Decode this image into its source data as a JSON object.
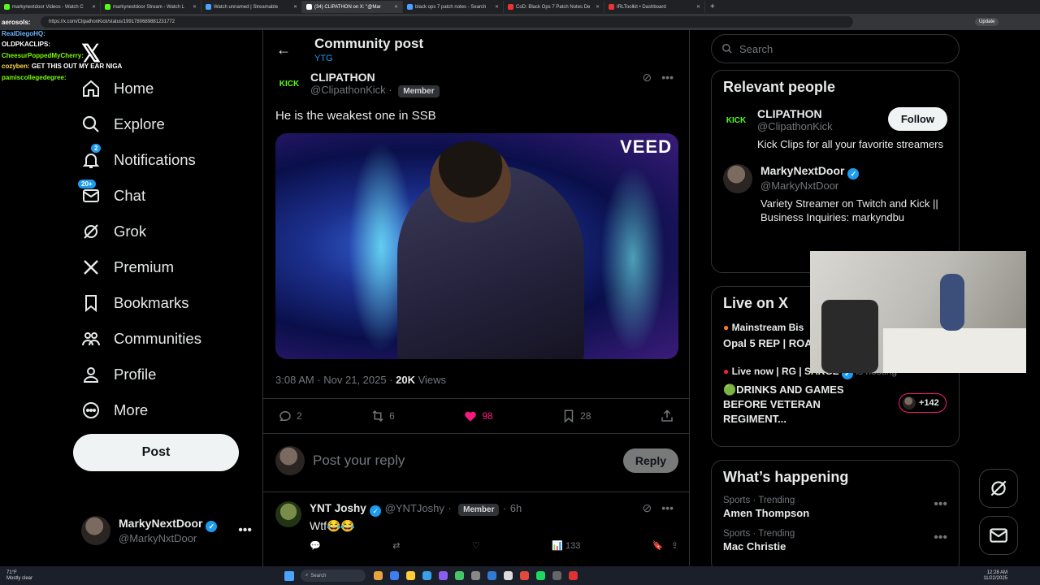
{
  "browser": {
    "tabs": [
      {
        "label": "markynextdoor Videos - Watch C",
        "active": false
      },
      {
        "label": "markynextdoor Stream - Watch L",
        "active": false
      },
      {
        "label": "Watch unnamed | Streamable",
        "active": false
      },
      {
        "label": "(34) CLIPATHON on X: \"@Mar",
        "active": true
      },
      {
        "label": "black ops 7 patch notes - Search",
        "active": false
      },
      {
        "label": "CoD: Black Ops 7 Patch Notes De",
        "active": false
      },
      {
        "label": "IRLToolkit • Dashboard",
        "active": false
      }
    ],
    "url": "https://x.com/ClipathonKick/status/1991780689881231772",
    "update_label": "Update"
  },
  "chat_overlay": [
    {
      "user": "aerosols:",
      "msg": ""
    },
    {
      "user": "RealDiegoHQ:",
      "msg": ""
    },
    {
      "user": "OLDPKACLIPS:",
      "msg": ""
    },
    {
      "user": "CheesurPoppedMyCherry:",
      "msg": ""
    },
    {
      "user": "cozyben:",
      "msg": "GET THIS OUT MY EAR NIGA"
    },
    {
      "user": "pamiscollegedegree:",
      "msg": ""
    }
  ],
  "nav": [
    {
      "label": "Home",
      "icon": "home-icon",
      "badge": ""
    },
    {
      "label": "Explore",
      "icon": "search-icon",
      "badge": ""
    },
    {
      "label": "Notifications",
      "icon": "bell-icon",
      "badge": "2"
    },
    {
      "label": "Chat",
      "icon": "mail-icon",
      "badge": "20+"
    },
    {
      "label": "Grok",
      "icon": "grok-icon",
      "badge": ""
    },
    {
      "label": "Premium",
      "icon": "x-icon",
      "badge": ""
    },
    {
      "label": "Bookmarks",
      "icon": "bookmark-icon",
      "badge": ""
    },
    {
      "label": "Communities",
      "icon": "communities-icon",
      "badge": ""
    },
    {
      "label": "Profile",
      "icon": "profile-icon",
      "badge": ""
    },
    {
      "label": "More",
      "icon": "more-icon",
      "badge": ""
    }
  ],
  "post_button": "Post",
  "me": {
    "name": "MarkyNextDoor",
    "handle": "@MarkyNxtDoor"
  },
  "header": {
    "title": "Community post",
    "subtitle": "YTG"
  },
  "post": {
    "name": "CLIPATHON",
    "handle": "@ClipathonKick",
    "member_label": "Member",
    "avatar_text": "KICK",
    "text": "He is the weakest one in SSB",
    "video_watermark": "VEED",
    "time": "3:08 AM · Nov 21, 2025 · ",
    "views": "20K",
    "views_label": " Views",
    "replies": "2",
    "reposts": "6",
    "likes": "98",
    "bookmarks": "28"
  },
  "reply_box": {
    "placeholder": "Post your reply",
    "button": "Reply"
  },
  "reply": {
    "name": "YNT Joshy",
    "handle": "@YNTJoshy",
    "member_label": "Member",
    "age": "6h",
    "text": "Wtf😂😂",
    "views": "133"
  },
  "right": {
    "search_placeholder": "Search",
    "relevant_title": "Relevant people",
    "people": [
      {
        "name": "CLIPATHON",
        "handle": "@ClipathonKick",
        "bio": "Kick Clips for all your favorite streamers",
        "follow": "Follow"
      },
      {
        "name": "MarkyNextDoor",
        "handle": "@MarkyNxtDoor",
        "bio": "Variety Streamer on Twitch and Kick || Business Inquiries: markyndbu"
      }
    ],
    "live_title": "Live on X",
    "live": [
      {
        "host": "Mainstream Bis",
        "title": "Opal 5 REP | ROA LIVE on Twitch/K"
      },
      {
        "host": "Live now | RG | SARGE",
        "hosting": "is hosting",
        "title": "🟢DRINKS AND GAMES BEFORE VETERAN REGIMENT...",
        "more": "+142"
      }
    ],
    "happening_title": "What’s happening",
    "trends": [
      {
        "category": "Sports · Trending",
        "title": "Amen Thompson"
      },
      {
        "category": "Sports · Trending",
        "title": "Mac Christie"
      }
    ]
  },
  "taskbar": {
    "weather_temp": "71°F",
    "weather_desc": "Mostly clear",
    "search": "Search",
    "time": "12:28 AM",
    "date": "11/22/2025"
  }
}
